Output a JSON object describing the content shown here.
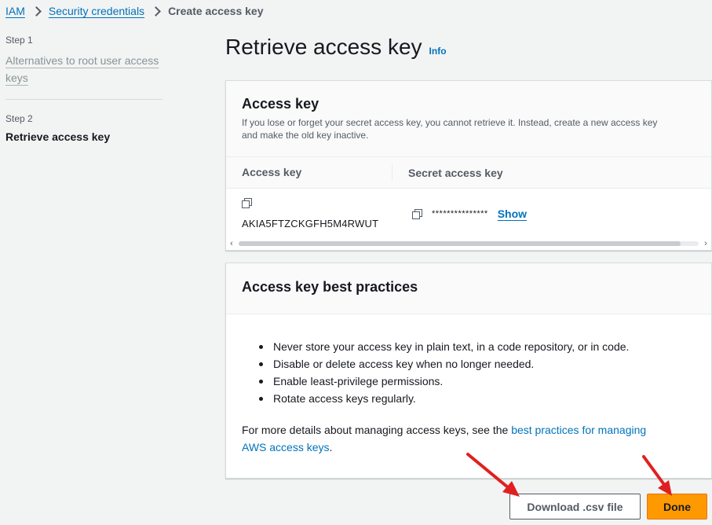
{
  "breadcrumb": {
    "items": [
      "IAM",
      "Security credentials"
    ],
    "current": "Create access key"
  },
  "steps": {
    "step1": {
      "num": "Step 1",
      "title": "Alternatives to root user access keys"
    },
    "step2": {
      "num": "Step 2",
      "title": "Retrieve access key"
    }
  },
  "page": {
    "title": "Retrieve access key",
    "info": "Info"
  },
  "access_key_panel": {
    "title": "Access key",
    "description": "If you lose or forget your secret access key, you cannot retrieve it. Instead, create a new access key and make the old key inactive.",
    "columns": [
      "Access key",
      "Secret access key"
    ],
    "access_key_value": "AKIA5FTZCKGFH5M4RWUT",
    "secret_mask": "***************",
    "show_label": "Show",
    "icons": {
      "copy": "copy-icon",
      "scroll_left": "chevron-left-icon",
      "scroll_right": "chevron-right-icon"
    }
  },
  "best_practices_panel": {
    "title": "Access key best practices",
    "items": [
      "Never store your access key in plain text, in a code repository, or in code.",
      "Disable or delete access key when no longer needed.",
      "Enable least-privilege permissions.",
      "Rotate access keys regularly."
    ],
    "more_prefix": "For more details about managing access keys, see the ",
    "more_link": "best practices for managing AWS access keys",
    "more_suffix": "."
  },
  "buttons": {
    "download": "Download .csv file",
    "done": "Done"
  },
  "colors": {
    "link": "#0073bb",
    "primary_button": "#ff9900",
    "annotation_arrow": "#e02020"
  }
}
